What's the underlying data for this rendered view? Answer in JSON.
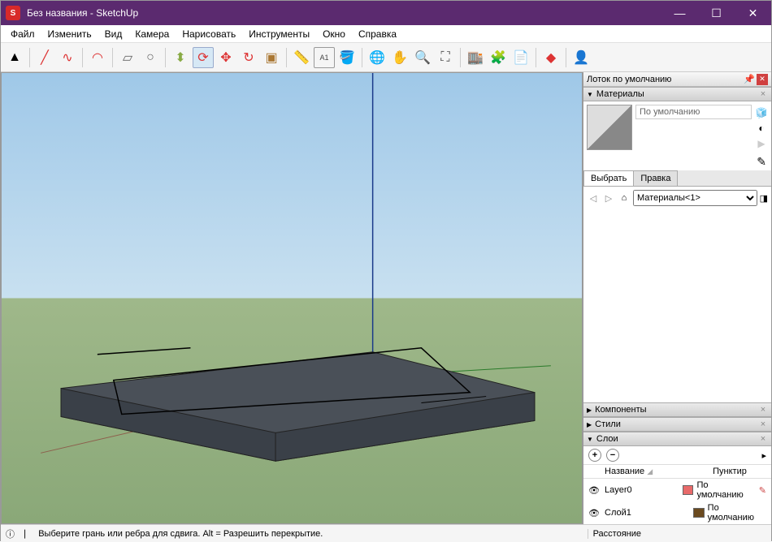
{
  "titlebar": {
    "text": "Без названия - SketchUp"
  },
  "menu": {
    "file": "Файл",
    "edit": "Изменить",
    "view": "Вид",
    "camera": "Камера",
    "draw": "Нарисовать",
    "tools": "Инструменты",
    "window": "Окно",
    "help": "Справка"
  },
  "tray": {
    "title": "Лоток по умолчанию",
    "materials": {
      "title": "Материалы",
      "current": "По умолчанию",
      "tab_select": "Выбрать",
      "tab_edit": "Правка",
      "dropdown": "Материалы<1>"
    },
    "components": {
      "title": "Компоненты"
    },
    "styles": {
      "title": "Стили"
    },
    "layers": {
      "title": "Слои",
      "col_name": "Название",
      "col_dashes": "Пунктир",
      "rows": [
        {
          "name": "Layer0",
          "color": "#e86a6a",
          "dash": "По умолчанию"
        },
        {
          "name": "Слой1",
          "color": "#6b4a1f",
          "dash": "По умолчанию"
        }
      ]
    }
  },
  "status": {
    "hint": "Выберите грань или ребра для сдвига. Alt = Разрешить перекрытие.",
    "distance_label": "Расстояние"
  }
}
